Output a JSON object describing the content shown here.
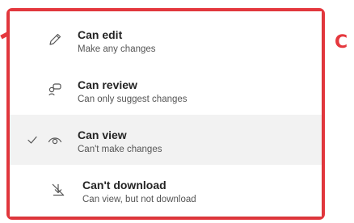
{
  "callout": {
    "letter": "C"
  },
  "colors": {
    "highlight": "#e5383e",
    "selected_bg": "#f2f2f2",
    "text": "#242424",
    "subtext": "#555555"
  },
  "menu": {
    "items": [
      {
        "title": "Can edit",
        "subtitle": "Make any changes",
        "icon": "pencil-icon",
        "selected": false
      },
      {
        "title": "Can review",
        "subtitle": "Can only suggest changes",
        "icon": "review-icon",
        "selected": false
      },
      {
        "title": "Can view",
        "subtitle": "Can't make changes",
        "icon": "eye-icon",
        "selected": true
      },
      {
        "title": "Can't download",
        "subtitle": "Can view, but not download",
        "icon": "no-download-icon",
        "selected": false
      }
    ]
  }
}
